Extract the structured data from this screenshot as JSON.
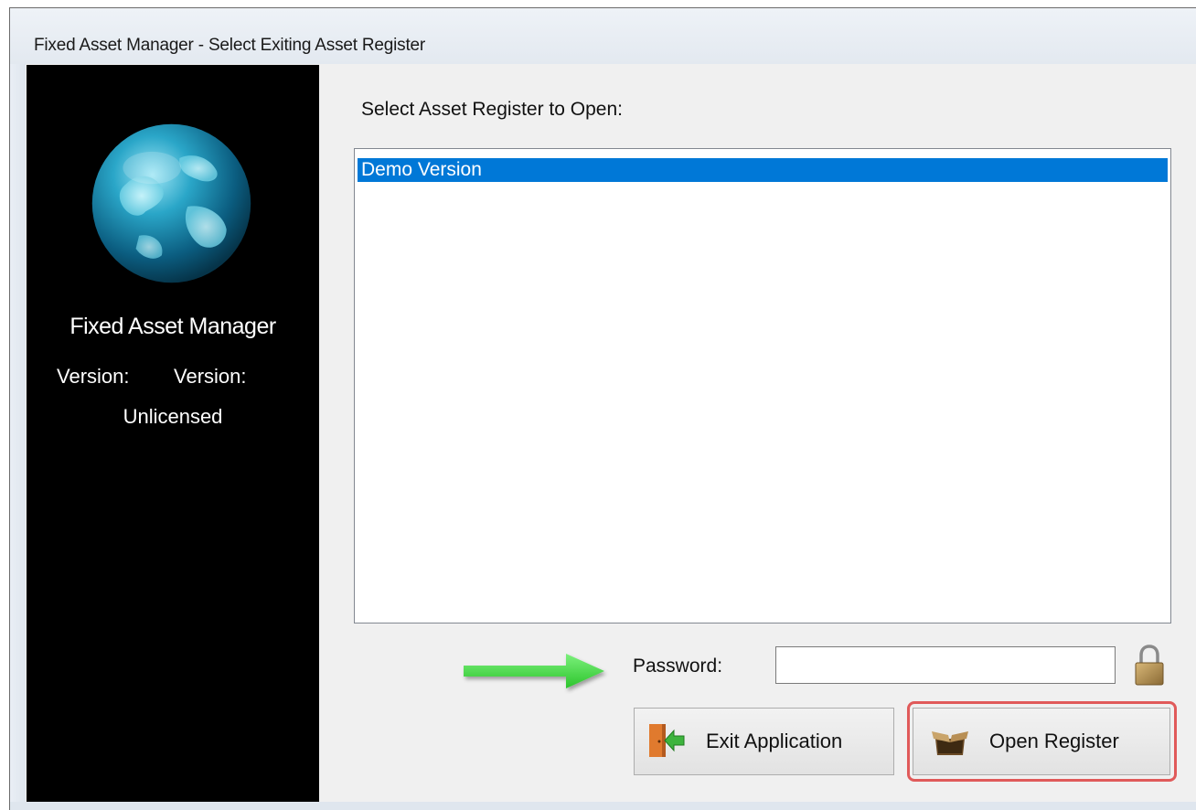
{
  "window": {
    "title": "Fixed Asset Manager - Select Exiting Asset Register"
  },
  "side_panel": {
    "logo_icon": "globe-icon",
    "product_name": "Fixed Asset Manager",
    "version_label": "Version:",
    "version_value": "Version:",
    "license_status": "Unlicensed"
  },
  "main": {
    "select_label": "Select Asset Register to Open:",
    "registers": [
      "Demo Version"
    ],
    "selected_register": "Demo Version",
    "password_label": "Password:",
    "password_value": "",
    "lock_icon": "lock-icon"
  },
  "buttons": {
    "exit_label": "Exit Application",
    "exit_icon": "exit-door-icon",
    "open_label": "Open Register",
    "open_icon": "open-box-icon"
  },
  "colors": {
    "selection": "#0078d7",
    "side_panel_bg": "#000000",
    "highlight": "#e05a5a",
    "arrow": "#3ddc3d"
  }
}
